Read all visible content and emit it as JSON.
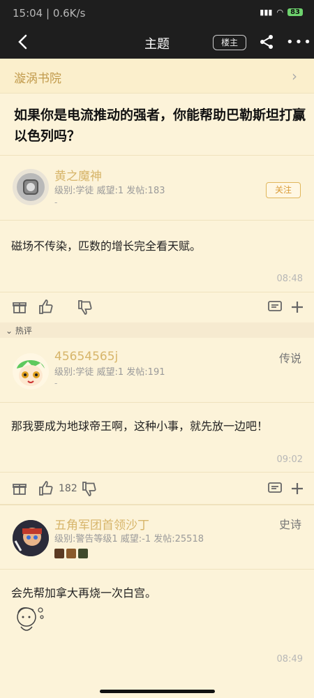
{
  "status": {
    "time": "15:04",
    "speed": "0.6K/s",
    "battery": "83"
  },
  "header": {
    "title": "主题",
    "op_button": "楼主"
  },
  "forum": {
    "name": "漩涡书院"
  },
  "thread": {
    "title": "如果你是电流推动的强者，你能帮助巴勒斯坦打赢以色列吗？"
  },
  "posts": [
    {
      "username": "黄之魔神",
      "meta": "级别:学徒  威望:1  发帖:183",
      "dash": "-",
      "follow": "关注",
      "content": "磁场不传染，匹数的增长完全看天赋。",
      "time": "08:48"
    },
    {
      "username": "45654565j",
      "meta": "级别:学徒  威望:1  发帖:191",
      "dash": "-",
      "rank": "传说",
      "content": "那我要成为地球帝王啊，这种小事，就先放一边吧！",
      "time": "09:02",
      "likes": "182"
    },
    {
      "username": "五角军团首领沙丁",
      "meta": "级别:警告等级1  威望:-1  发帖:25518",
      "rank": "史诗",
      "content": "会先帮加拿大再烧一次白宫。",
      "time": "08:49"
    }
  ],
  "hot_label": "热评",
  "colors": {
    "background": "#fcf3d9",
    "accent": "#d7b56a",
    "header": "#1e1e1e"
  }
}
